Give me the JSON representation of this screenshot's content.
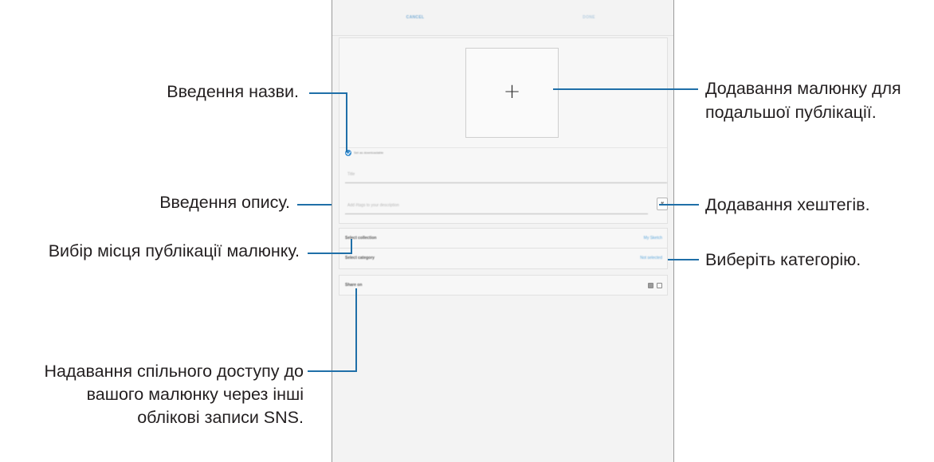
{
  "screen": {
    "topbar": {
      "cancel_label": "CANCEL",
      "done_label": "DONE"
    },
    "form": {
      "set_as_wallpaper_label": "Set as downloadable",
      "title_placeholder": "Title",
      "description_placeholder": "Add #tags to your description",
      "hashtag_label": "#"
    },
    "rows": {
      "collection_label": "Select collection",
      "collection_value": "My Sketch",
      "category_label": "Select category",
      "category_value": "Not selected",
      "share_label": "Share on"
    },
    "icons": {
      "add_image": "plus-icon",
      "checkbox": "check-icon",
      "facebook": "facebook-icon",
      "twitter": "twitter-icon"
    }
  },
  "callouts": {
    "title_entry": "Введення назви.",
    "description_entry": "Введення опису.",
    "publish_place": "Вибір місця публікації малюнку.",
    "share_line1": "Надавання спільного доступу до",
    "share_line2": "вашого малюнку через інші",
    "share_line3": "облікові записи SNS.",
    "add_image_line1": "Додавання малюнку для",
    "add_image_line2": "подальшої публікації.",
    "add_hashtags": "Додавання хештегів.",
    "choose_category": "Виберіть категорію."
  },
  "colors": {
    "callout_line": "#1f6fa8",
    "accent": "#3b8fd0"
  }
}
